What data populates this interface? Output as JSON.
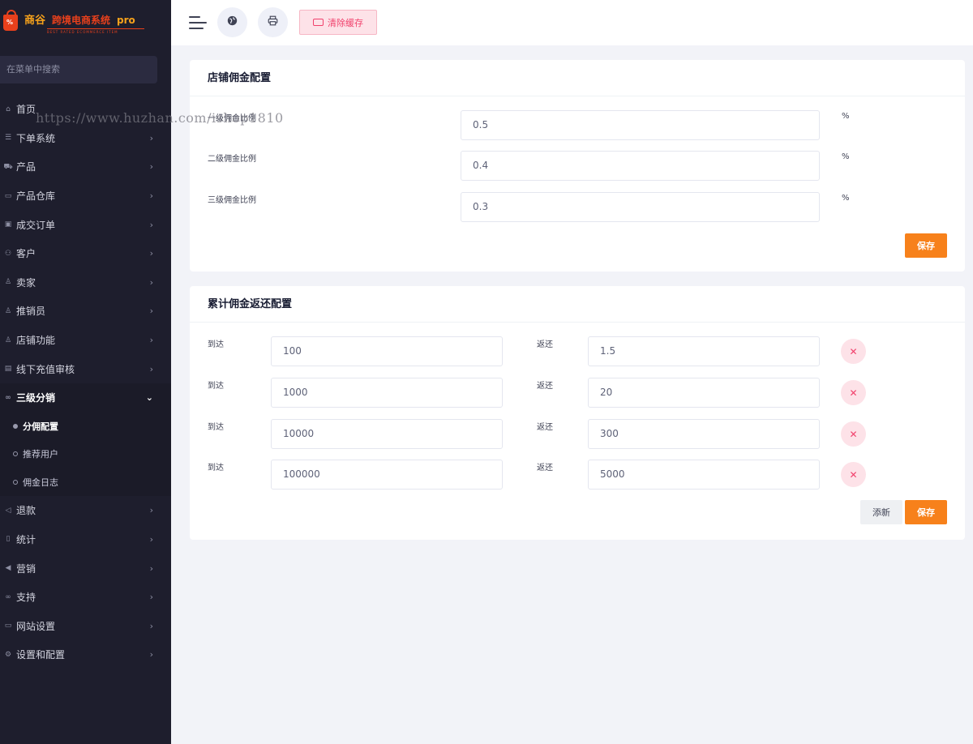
{
  "brand": {
    "name_part1": "商谷",
    "name_part2": "跨境电商系统",
    "name_part3": "pro",
    "tagline": "BEST RATED ECOMMERCE ITEM"
  },
  "search": {
    "placeholder": "在菜单中搜索"
  },
  "menu": [
    {
      "label": "首页",
      "icon": "home-icon",
      "arrow": false
    },
    {
      "label": "下单系统",
      "icon": "list-icon",
      "arrow": true
    },
    {
      "label": "产品",
      "icon": "cart-icon",
      "arrow": true
    },
    {
      "label": "产品仓库",
      "icon": "box-icon",
      "arrow": true
    },
    {
      "label": "成交订单",
      "icon": "ticket-icon",
      "arrow": true
    },
    {
      "label": "客户",
      "icon": "users-icon",
      "arrow": true
    },
    {
      "label": "卖家",
      "icon": "user-icon",
      "arrow": true
    },
    {
      "label": "推销员",
      "icon": "user-icon",
      "arrow": true
    },
    {
      "label": "店铺功能",
      "icon": "user-icon",
      "arrow": true
    },
    {
      "label": "线下充值审核",
      "icon": "money-icon",
      "arrow": true
    },
    {
      "label": "三级分销",
      "icon": "link-icon",
      "arrow": true,
      "open": true
    }
  ],
  "submenu": [
    {
      "label": "分佣配置",
      "active": true
    },
    {
      "label": "推荐用户",
      "active": false
    },
    {
      "label": "佣金日志",
      "active": false
    }
  ],
  "menu_after": [
    {
      "label": "退款",
      "icon": "back-icon"
    },
    {
      "label": "统计",
      "icon": "file-icon"
    },
    {
      "label": "营销",
      "icon": "megaphone-icon"
    },
    {
      "label": "支持",
      "icon": "link-icon"
    },
    {
      "label": "网站设置",
      "icon": "monitor-icon"
    },
    {
      "label": "设置和配置",
      "icon": "gear-icon"
    }
  ],
  "header": {
    "clear_cache_label": "清除缓存"
  },
  "commission": {
    "title": "店铺佣金配置",
    "rows": [
      {
        "label": "一级佣金比例",
        "value": "0.5",
        "unit": "%"
      },
      {
        "label": "二级佣金比例",
        "value": "0.4",
        "unit": "%"
      },
      {
        "label": "三级佣金比例",
        "value": "0.3",
        "unit": "%"
      }
    ],
    "save_label": "保存"
  },
  "cumulative": {
    "title": "累计佣金返还配置",
    "reach_label": "到达",
    "return_label": "返还",
    "rows": [
      {
        "reach": "100",
        "return": "1.5"
      },
      {
        "reach": "1000",
        "return": "20"
      },
      {
        "reach": "10000",
        "return": "300"
      },
      {
        "reach": "100000",
        "return": "5000"
      }
    ],
    "add_label": "添新",
    "save_label": "保存"
  },
  "watermark": "https://www.huzhan.com/ishop1810"
}
